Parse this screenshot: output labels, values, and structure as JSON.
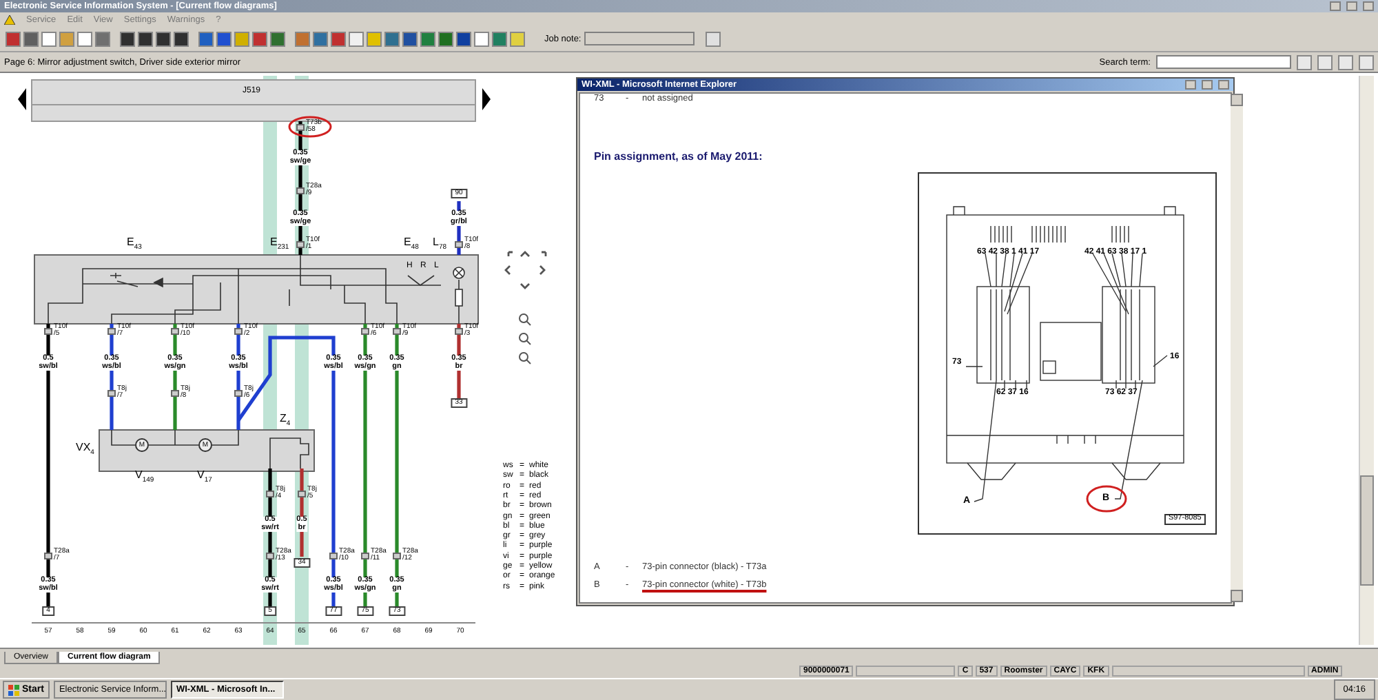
{
  "window": {
    "title": "Electronic Service Information System - [Current flow diagrams]"
  },
  "menu": [
    "Service",
    "Edit",
    "View",
    "Settings",
    "Warnings",
    "?"
  ],
  "toolbar": {
    "job_note_label": "Job note:"
  },
  "page_bar": {
    "page_title": "Page 6: Mirror adjustment switch, Driver side exterior mirror",
    "search_label": "Search term:"
  },
  "diagram": {
    "top_component": "J519",
    "component_labels": [
      "E$_{43}$",
      "E$_{231}$",
      "E$_{48}$",
      "L$_{78}$",
      "VX$_{4}$",
      "V$_{149}$",
      "V$_{17}$",
      "Z$_{4}$"
    ],
    "switch_positions": [
      "H",
      "R",
      "L"
    ],
    "motor_symbols": [
      "M",
      "M"
    ],
    "wires": [
      {
        "color": "#000000",
        "circled": true,
        "labels": [
          {
            "kind": "pin",
            "text": "T73b\n/58"
          },
          {
            "kind": "gauge",
            "text": "0.35\nsw/ge"
          },
          {
            "kind": "pin",
            "text": "T28a\n/9"
          },
          {
            "kind": "gauge",
            "text": "0.35\nsw/ge"
          },
          {
            "kind": "pin",
            "text": "T10f\n/1"
          }
        ]
      },
      {
        "color": "#2030c0",
        "circled": false,
        "labels": [
          {
            "kind": "terminal",
            "text": "90"
          },
          {
            "kind": "gauge",
            "text": "0.35\ngr/bl"
          },
          {
            "kind": "pin",
            "text": "T10f\n/8"
          }
        ]
      },
      {
        "color": "#000000",
        "circled": false,
        "labels": [
          {
            "kind": "pin",
            "text": "T10f\n/5"
          },
          {
            "kind": "gauge",
            "text": "0.5\nsw/bl"
          },
          {
            "kind": "pin",
            "text": "T28a\n/7"
          },
          {
            "kind": "gauge",
            "text": "0.35\nsw/bl"
          },
          {
            "kind": "terminal",
            "text": "4"
          }
        ]
      },
      {
        "color": "#1f3fd0",
        "circled": false,
        "labels": [
          {
            "kind": "pin",
            "text": "T10f\n/7"
          },
          {
            "kind": "gauge",
            "text": "0.35\nws/bl"
          },
          {
            "kind": "pin",
            "text": "T8j\n/7"
          }
        ]
      },
      {
        "color": "#2a8a2a",
        "circled": false,
        "labels": [
          {
            "kind": "pin",
            "text": "T10f\n/10"
          },
          {
            "kind": "gauge",
            "text": "0.35\nws/gn"
          },
          {
            "kind": "pin",
            "text": "T8j\n/8"
          }
        ]
      },
      {
        "color": "#1f3fd0",
        "circled": false,
        "labels": [
          {
            "kind": "pin",
            "text": "T10f\n/2"
          },
          {
            "kind": "gauge",
            "text": "0.35\nws/bl"
          },
          {
            "kind": "pin",
            "text": "T8j\n/6"
          }
        ]
      },
      {
        "color": "#1f3fd0",
        "circled": false,
        "labels": [
          {
            "kind": "gauge",
            "text": "0.35\nws/bl"
          },
          {
            "kind": "pin",
            "text": "T28a\n/10"
          },
          {
            "kind": "gauge",
            "text": "0.35\nws/bl"
          },
          {
            "kind": "terminal",
            "text": "77"
          }
        ]
      },
      {
        "color": "#2a8a2a",
        "circled": false,
        "labels": [
          {
            "kind": "pin",
            "text": "T10f\n/6"
          },
          {
            "kind": "gauge",
            "text": "0.35\nws/gn"
          },
          {
            "kind": "pin",
            "text": "T28a\n/11"
          },
          {
            "kind": "gauge",
            "text": "0.35\nws/gn"
          },
          {
            "kind": "terminal",
            "text": "75"
          }
        ]
      },
      {
        "color": "#2a8a2a",
        "circled": false,
        "labels": [
          {
            "kind": "pin",
            "text": "T10f\n/9"
          },
          {
            "kind": "gauge",
            "text": "0.35\ngn"
          },
          {
            "kind": "pin",
            "text": "T28a\n/12"
          },
          {
            "kind": "gauge",
            "text": "0.35\ngn"
          },
          {
            "kind": "terminal",
            "text": "73"
          }
        ]
      },
      {
        "color": "#b03030",
        "circled": false,
        "labels": [
          {
            "kind": "pin",
            "text": "T10f\n/3"
          },
          {
            "kind": "gauge",
            "text": "0.35\nbr"
          },
          {
            "kind": "terminal",
            "text": "33"
          }
        ]
      },
      {
        "color": "#000000",
        "circled": false,
        "labels": [
          {
            "kind": "pin",
            "text": "T8j\n/4"
          },
          {
            "kind": "gauge",
            "text": "0.5\nsw/rt"
          },
          {
            "kind": "pin",
            "text": "T28a\n/13"
          },
          {
            "kind": "gauge",
            "text": "0.5\nsw/rt"
          },
          {
            "kind": "terminal",
            "text": "5"
          }
        ]
      },
      {
        "color": "#b03030",
        "circled": false,
        "labels": [
          {
            "kind": "pin",
            "text": "T8j\n/5"
          },
          {
            "kind": "gauge",
            "text": "0.5\nbr"
          },
          {
            "kind": "terminal",
            "text": "34"
          }
        ]
      }
    ],
    "grid_numbers": [
      "57",
      "58",
      "59",
      "60",
      "61",
      "62",
      "63",
      "64",
      "65",
      "66",
      "67",
      "68",
      "69",
      "70"
    ],
    "legend": [
      {
        "code": "ws",
        "sign": "=",
        "meaning": "white"
      },
      {
        "code": "sw",
        "sign": "=",
        "meaning": "black"
      },
      {
        "code": "ro",
        "sign": "=",
        "meaning": "red"
      },
      {
        "code": "rt",
        "sign": "=",
        "meaning": "red"
      },
      {
        "code": "br",
        "sign": "=",
        "meaning": "brown"
      },
      {
        "code": "gn",
        "sign": "=",
        "meaning": "green"
      },
      {
        "code": "bl",
        "sign": "=",
        "meaning": "blue"
      },
      {
        "code": "gr",
        "sign": "=",
        "meaning": "grey"
      },
      {
        "code": "li",
        "sign": "=",
        "meaning": "purple"
      },
      {
        "code": "vi",
        "sign": "=",
        "meaning": "purple"
      },
      {
        "code": "ge",
        "sign": "=",
        "meaning": "yellow"
      },
      {
        "code": "or",
        "sign": "=",
        "meaning": "orange"
      },
      {
        "code": "rs",
        "sign": "=",
        "meaning": "pink"
      }
    ]
  },
  "popup": {
    "title": "WI-XML - Microsoft Internet Explorer",
    "top_row": {
      "number": "73",
      "dash": "-",
      "text": "not assigned"
    },
    "heading": "Pin assignment, as of May 2011:",
    "figure": {
      "pin_labels": [
        "63 42 38 1 41 17",
        "42 41 63 38 17 1",
        "73",
        "62 37 16",
        "73 62 37",
        "16"
      ],
      "callouts": [
        {
          "text": "A",
          "circled": false
        },
        {
          "text": "B",
          "circled": true
        }
      ],
      "figure_id": "S97-8085"
    },
    "items": [
      {
        "letter": "A",
        "dash": "-",
        "text": "73-pin connector (black) - T73a",
        "underlined": false
      },
      {
        "letter": "B",
        "dash": "-",
        "text": "73-pin connector (white) - T73b",
        "underlined": true
      }
    ]
  },
  "tabs": [
    {
      "label": "Overview",
      "selected": false
    },
    {
      "label": "Current flow diagram",
      "selected": true
    }
  ],
  "status_bar": [
    "9000000071",
    "C",
    "537",
    "Roomster",
    "CAYC",
    "KFK",
    "ADMIN"
  ],
  "taskbar": {
    "start": "Start",
    "tasks": [
      {
        "label": "Electronic Service Inform...",
        "selected": false
      },
      {
        "label": "WI-XML - Microsoft In...",
        "selected": true
      }
    ],
    "clock": "04:16"
  }
}
